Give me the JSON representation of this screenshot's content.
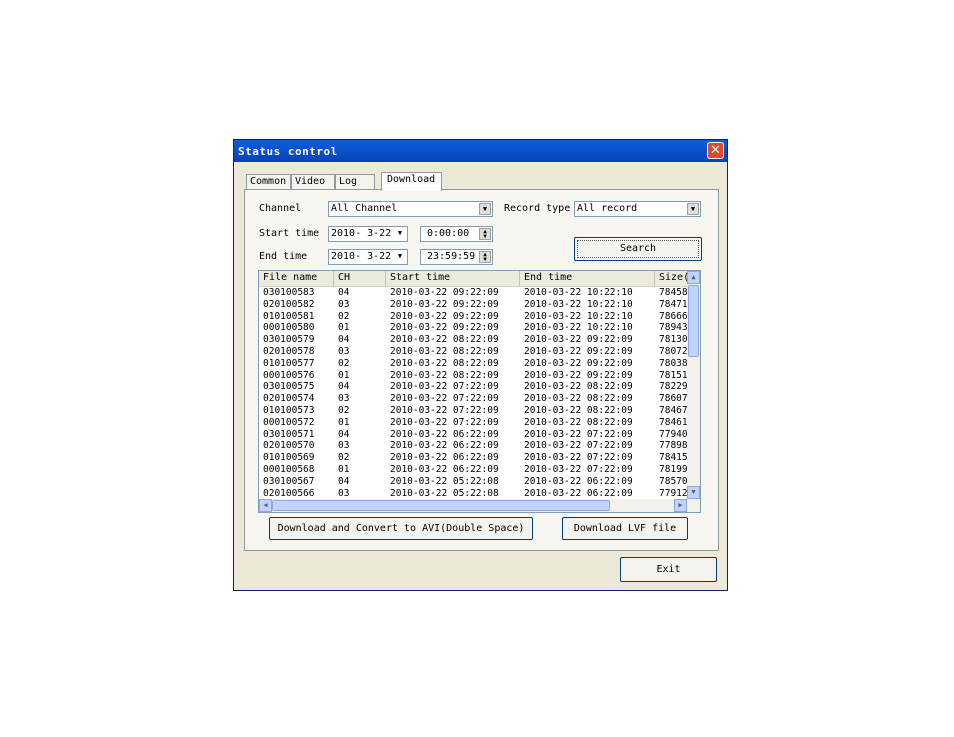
{
  "window": {
    "title": "Status control",
    "close_symbol": "✕"
  },
  "tabs": [
    "Common",
    "Video",
    "Log",
    "Download"
  ],
  "filters": {
    "channel_label": "Channel",
    "channel_value": "All Channel",
    "record_type_label": "Record type",
    "record_type_value": "All record",
    "start_label": "Start time",
    "start_date": "2010- 3-22",
    "start_time": "0:00:00",
    "end_label": "End time",
    "end_date": "2010- 3-22",
    "end_time": "23:59:59",
    "search_label": "Search"
  },
  "list": {
    "columns": [
      "File name",
      "CH",
      "Start time",
      "End time",
      "Size("
    ],
    "rows": [
      [
        "030100583",
        "04",
        "2010-03-22 09:22:09",
        "2010-03-22 10:22:10",
        "78458"
      ],
      [
        "020100582",
        "03",
        "2010-03-22 09:22:09",
        "2010-03-22 10:22:10",
        "78471"
      ],
      [
        "010100581",
        "02",
        "2010-03-22 09:22:09",
        "2010-03-22 10:22:10",
        "78666"
      ],
      [
        "000100580",
        "01",
        "2010-03-22 09:22:09",
        "2010-03-22 10:22:10",
        "78943"
      ],
      [
        "030100579",
        "04",
        "2010-03-22 08:22:09",
        "2010-03-22 09:22:09",
        "78130"
      ],
      [
        "020100578",
        "03",
        "2010-03-22 08:22:09",
        "2010-03-22 09:22:09",
        "78072"
      ],
      [
        "010100577",
        "02",
        "2010-03-22 08:22:09",
        "2010-03-22 09:22:09",
        "78038"
      ],
      [
        "000100576",
        "01",
        "2010-03-22 08:22:09",
        "2010-03-22 09:22:09",
        "78151"
      ],
      [
        "030100575",
        "04",
        "2010-03-22 07:22:09",
        "2010-03-22 08:22:09",
        "78229"
      ],
      [
        "020100574",
        "03",
        "2010-03-22 07:22:09",
        "2010-03-22 08:22:09",
        "78607"
      ],
      [
        "010100573",
        "02",
        "2010-03-22 07:22:09",
        "2010-03-22 08:22:09",
        "78467"
      ],
      [
        "000100572",
        "01",
        "2010-03-22 07:22:09",
        "2010-03-22 08:22:09",
        "78461"
      ],
      [
        "030100571",
        "04",
        "2010-03-22 06:22:09",
        "2010-03-22 07:22:09",
        "77940"
      ],
      [
        "020100570",
        "03",
        "2010-03-22 06:22:09",
        "2010-03-22 07:22:09",
        "77898"
      ],
      [
        "010100569",
        "02",
        "2010-03-22 06:22:09",
        "2010-03-22 07:22:09",
        "78415"
      ],
      [
        "000100568",
        "01",
        "2010-03-22 06:22:09",
        "2010-03-22 07:22:09",
        "78199"
      ],
      [
        "030100567",
        "04",
        "2010-03-22 05:22:08",
        "2010-03-22 06:22:09",
        "78570"
      ],
      [
        "020100566",
        "03",
        "2010-03-22 05:22:08",
        "2010-03-22 06:22:09",
        "77912"
      ]
    ]
  },
  "actions": {
    "convert_label": "Download and Convert to AVI(Double Space)",
    "lvf_label": "Download LVF file",
    "exit_label": "Exit"
  }
}
